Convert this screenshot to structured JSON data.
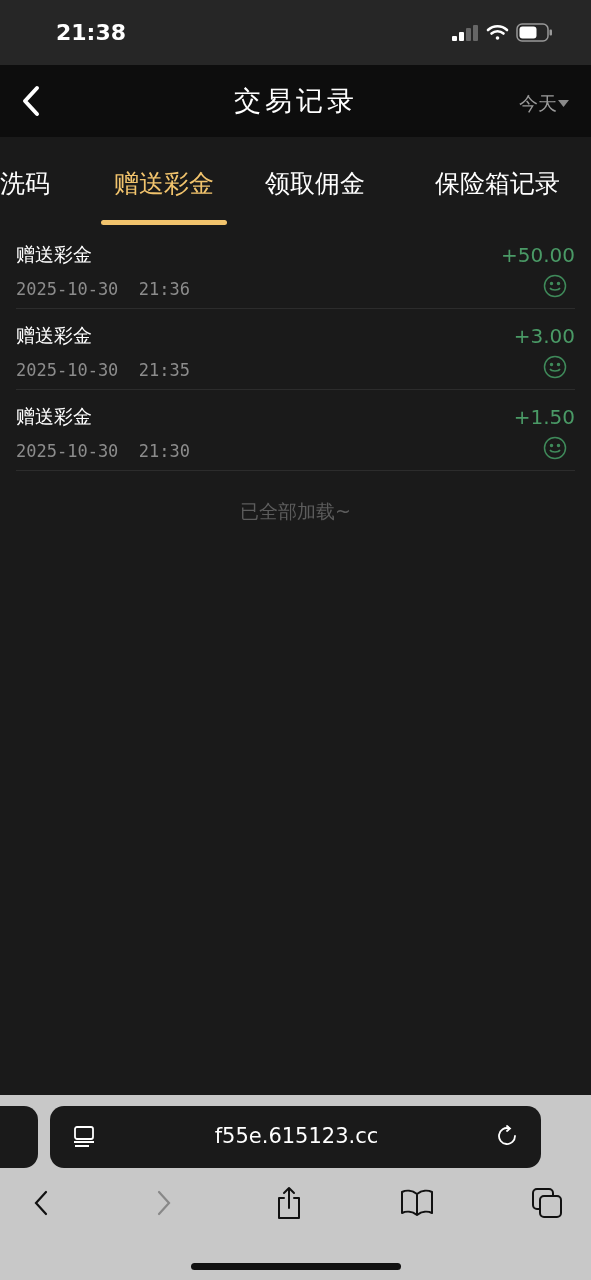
{
  "status_bar": {
    "time": "21:38"
  },
  "header": {
    "title": "交易记录",
    "filter": "今天"
  },
  "tabs": [
    {
      "label": "洗码",
      "selected": false
    },
    {
      "label": "赠送彩金",
      "selected": true
    },
    {
      "label": "领取佣金",
      "selected": false
    },
    {
      "label": "保险箱记录",
      "selected": false
    }
  ],
  "records": [
    {
      "title": "赠送彩金",
      "time": "2025-10-30  21:36",
      "amount": "+50.00"
    },
    {
      "title": "赠送彩金",
      "time": "2025-10-30  21:35",
      "amount": "+3.00"
    },
    {
      "title": "赠送彩金",
      "time": "2025-10-30  21:30",
      "amount": "+1.50"
    }
  ],
  "end_note": "已全部加载~",
  "browser": {
    "url": "f55e.615123.cc",
    "back_disabled": false,
    "forward_disabled": true
  }
}
